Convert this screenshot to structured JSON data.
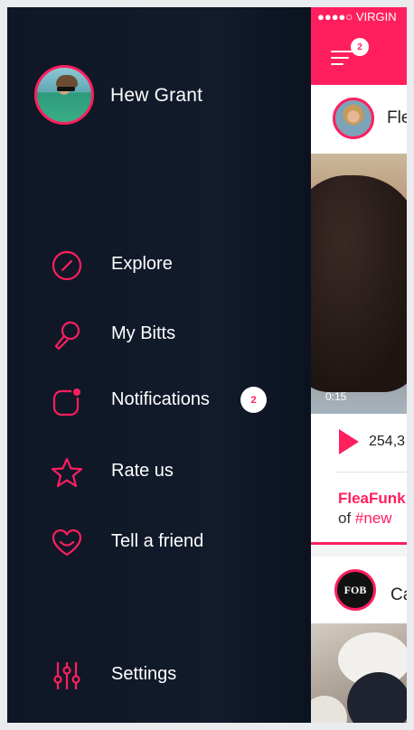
{
  "profile": {
    "name": "Hew Grant"
  },
  "menu": [
    {
      "label": "Explore",
      "icon": "compass-icon"
    },
    {
      "label": "My Bitts",
      "icon": "microphone-icon"
    },
    {
      "label": "Notifications",
      "icon": "notification-icon",
      "badge": "2"
    },
    {
      "label": "Rate us",
      "icon": "star-icon"
    },
    {
      "label": "Tell a friend",
      "icon": "heart-smile-icon"
    },
    {
      "label": "Settings",
      "icon": "sliders-icon"
    }
  ],
  "status_bar": {
    "carrier": "●●●●○ VIRGIN"
  },
  "header": {
    "menu_badge": "2"
  },
  "feed": {
    "post1": {
      "name": "Fle",
      "video_time": "0:15",
      "views": "254,3",
      "caption_user": "FleaFunk",
      "caption_prefix": "of ",
      "caption_tag": "#new"
    },
    "post2": {
      "name": "Ca",
      "avatar_text": "FOB"
    }
  },
  "colors": {
    "accent": "#ff1f5e",
    "drawer_bg": "#0f1726"
  }
}
